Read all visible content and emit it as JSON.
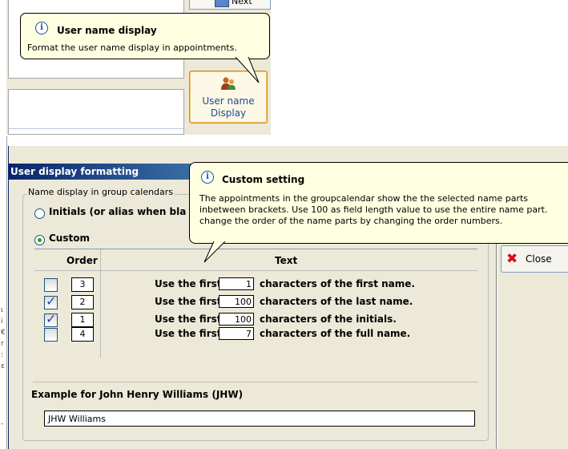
{
  "top_panel": {
    "next_button": "Next",
    "user_button_line1": "User name",
    "user_button_line2": "Display",
    "tooltip": {
      "title": "User name display",
      "body": "Format the user name display in appointments."
    }
  },
  "dialog": {
    "title": "User display formatting",
    "group_legend": "Name display in group calendars",
    "radio_initials": "Initials (or alias when bla",
    "radio_custom": "Custom",
    "header_order": "Order",
    "header_text": "Text",
    "rows": [
      {
        "checked": false,
        "order": "3",
        "prefix": "Use the first",
        "length": "1",
        "suffix": "characters of the first name."
      },
      {
        "checked": true,
        "order": "2",
        "prefix": "Use the first",
        "length": "100",
        "suffix": "characters of the last name."
      },
      {
        "checked": true,
        "order": "1",
        "prefix": "Use the first",
        "length": "100",
        "suffix": "characters of the initials."
      },
      {
        "checked": false,
        "order": "4",
        "prefix": "Use the first",
        "length": "7",
        "suffix": "characters of the full name."
      }
    ],
    "example_label": "Example for John Henry Williams (JHW)",
    "example_value": "JHW Williams",
    "close_button": "Close",
    "tooltip": {
      "title": "Custom setting",
      "line1": "The appointments in the groupcalendar show the the selected name parts",
      "line2": "inbetween brackets. Use 100 as field length value to use the entire name part.",
      "line3": "change the order of the name parts by changing the order numbers."
    }
  }
}
